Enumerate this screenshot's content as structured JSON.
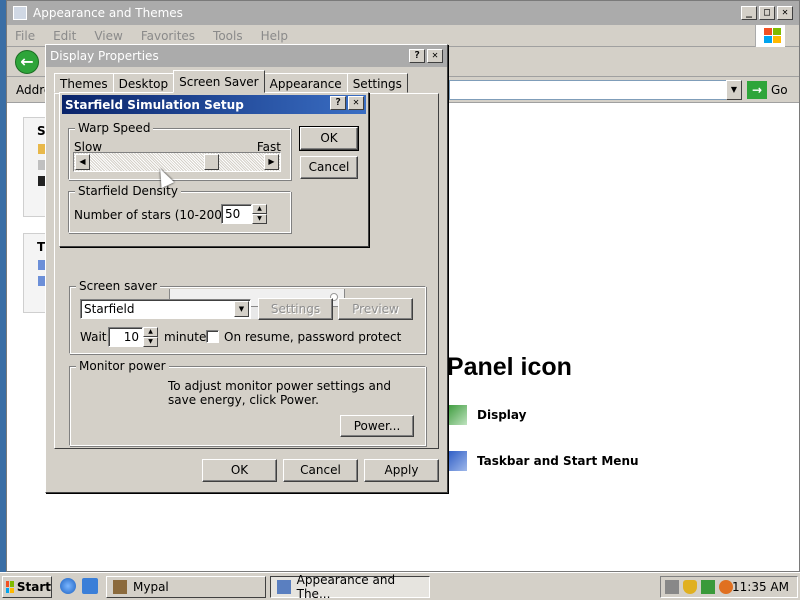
{
  "explorer": {
    "title": "Appearance and Themes",
    "menu": [
      "File",
      "Edit",
      "View",
      "Favorites",
      "Tools",
      "Help"
    ],
    "address_label": "Addre",
    "go_label": "Go",
    "panel1_head": "S",
    "panel2_head": "T",
    "heading_fragment": "l Panel icon",
    "links": [
      "Display",
      "Taskbar and Start Menu"
    ]
  },
  "display_properties": {
    "title": "Display Properties",
    "tabs": [
      "Themes",
      "Desktop",
      "Screen Saver",
      "Appearance",
      "Settings"
    ],
    "active_tab": "Screen Saver",
    "screen_saver_group": "Screen saver",
    "screen_saver_value": "Starfield",
    "settings_btn": "Settings",
    "preview_btn": "Preview",
    "wait_label": "Wait:",
    "wait_value": "10",
    "minutes_label": "minutes",
    "password_label": "On resume, password protect",
    "monitor_group": "Monitor power",
    "monitor_text": "To adjust monitor power settings and save energy, click Power.",
    "power_btn": "Power...",
    "ok_btn": "OK",
    "cancel_btn": "Cancel",
    "apply_btn": "Apply"
  },
  "starfield_setup": {
    "title": "Starfield Simulation Setup",
    "warp_group": "Warp Speed",
    "slow_label": "Slow",
    "fast_label": "Fast",
    "warp_level": 0.72,
    "density_group": "Starfield Density",
    "stars_label": "Number of stars (10-200)",
    "stars_value": "50",
    "ok_btn": "OK",
    "cancel_btn": "Cancel"
  },
  "taskbar": {
    "start_label": "Start",
    "tasks": [
      "Mypal",
      "Appearance and The..."
    ],
    "clock": "11:35 AM"
  },
  "colors": {
    "desktop": "#3a6ea5",
    "active_title_start": "#0a246a",
    "active_title_end": "#3a6ec4",
    "inactive_title": "#ababab",
    "face": "#d4d0c8"
  }
}
